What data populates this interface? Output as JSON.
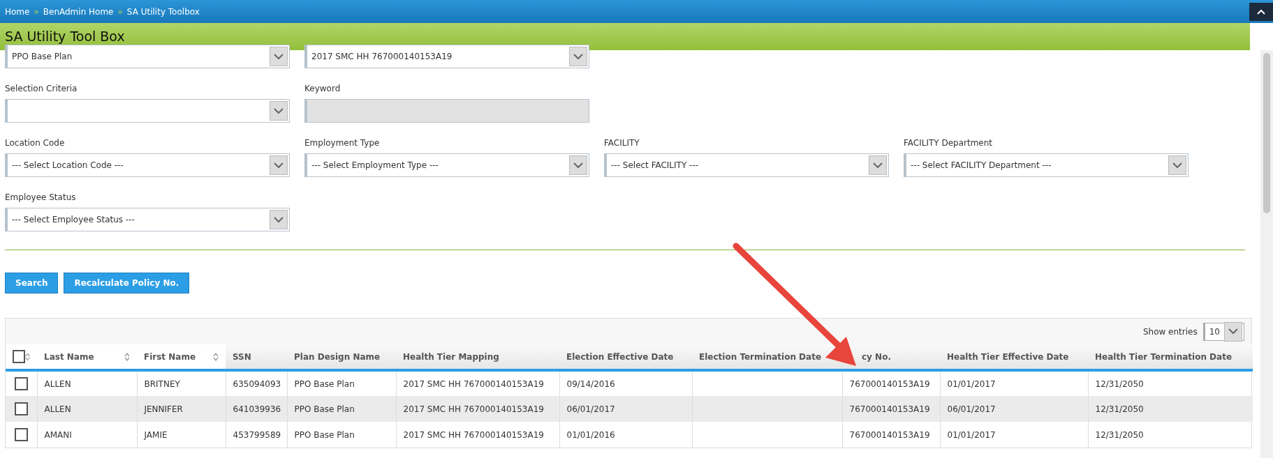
{
  "breadcrumb": [
    "Home",
    "BenAdmin Home",
    "SA Utility Toolbox"
  ],
  "breadcrumb_separator": "»",
  "page_title": "SA Utility Tool Box",
  "form_rows": [
    [
      {
        "kind": "select",
        "value": "PPO Base Plan"
      },
      {
        "kind": "select",
        "value": "2017 SMC HH 767000140153A19"
      }
    ],
    [
      {
        "kind": "select",
        "label": "Selection Criteria"
      },
      {
        "kind": "text",
        "label": "Keyword",
        "disabled": true
      }
    ],
    [
      {
        "kind": "select",
        "label": "Location Code",
        "value": "--- Select Location Code ---"
      },
      {
        "kind": "select",
        "label": "Employment Type",
        "value": "--- Select Employment Type ---"
      },
      {
        "kind": "select",
        "label": "FACILITY",
        "value": "--- Select FACILITY ---"
      },
      {
        "kind": "select",
        "label": "FACILITY Department",
        "value": "--- Select FACILITY Department ---"
      }
    ],
    [
      {
        "kind": "select",
        "label": "Employee Status",
        "value": "--- Select Employee Status ---"
      }
    ]
  ],
  "buttons": [
    "Search",
    "Recalculate Policy No."
  ],
  "table": {
    "show_entries_label": "Show entries",
    "show_entries_value": "10",
    "select_all_checked": false,
    "columns": [
      {
        "label": "Last Name",
        "sortable": true
      },
      {
        "label": "First Name",
        "sortable": true
      },
      {
        "label": "SSN",
        "sortable": false
      },
      {
        "label": "Plan Design Name",
        "sortable": false
      },
      {
        "label": "Health Tier Mapping",
        "sortable": false
      },
      {
        "label": "Election Effective Date",
        "sortable": false
      },
      {
        "label": "Election Termination Date",
        "sortable": false
      },
      {
        "label": "cy No.",
        "sortable": false
      },
      {
        "label": "Health Tier Effective Date",
        "sortable": false
      },
      {
        "label": "Health Tier Termination Date",
        "sortable": false
      }
    ],
    "rows": [
      {
        "checked": false,
        "cells": [
          "ALLEN",
          "BRITNEY",
          "635094093",
          "PPO Base Plan",
          "2017 SMC HH 767000140153A19",
          "09/14/2016",
          "",
          "767000140153A19",
          "01/01/2017",
          "12/31/2050"
        ]
      },
      {
        "checked": false,
        "cells": [
          "ALLEN",
          "JENNIFER",
          "641039936",
          "PPO Base Plan",
          "2017 SMC HH 767000140153A19",
          "06/01/2017",
          "",
          "767000140153A19",
          "06/01/2017",
          "12/31/2050"
        ]
      },
      {
        "checked": false,
        "cells": [
          "AMANI",
          "JAMIE",
          "453799589",
          "PPO Base Plan",
          "2017 SMC HH 767000140153A19",
          "01/01/2016",
          "",
          "767000140153A19",
          "01/01/2017",
          "12/31/2050"
        ]
      }
    ]
  }
}
